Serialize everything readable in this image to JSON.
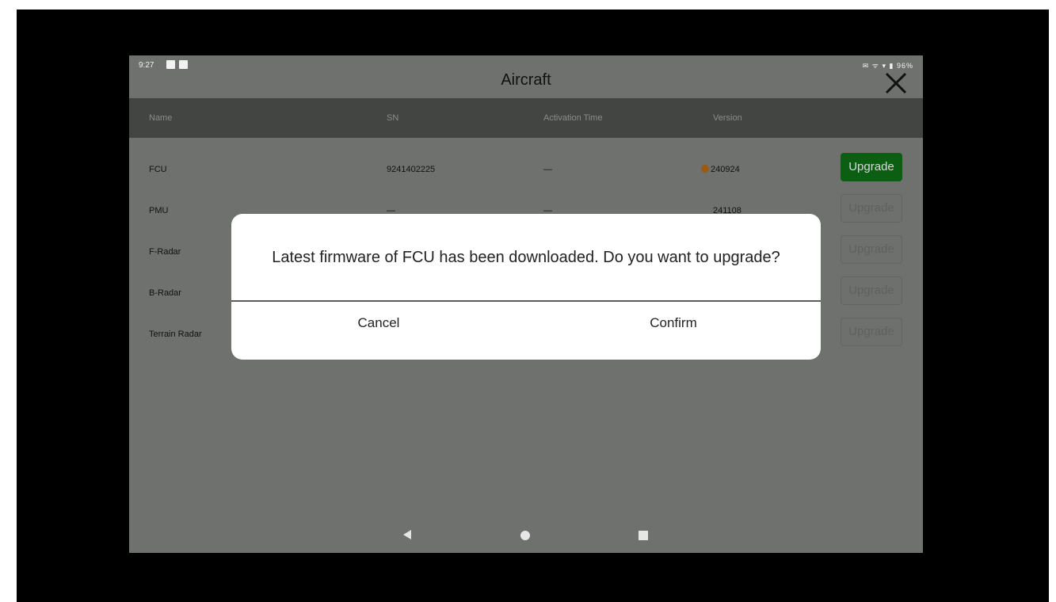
{
  "statusbar": {
    "time": "9:27",
    "right_icons": "✉ ᯤ ▾ ▮ 96%"
  },
  "header": {
    "title": "Aircraft"
  },
  "table": {
    "columns": [
      "Name",
      "SN",
      "Activation Time",
      "Version"
    ],
    "rows": [
      {
        "name": "FCU",
        "sn": "9241402225",
        "activation": "—",
        "version": "240924",
        "button": "Upgrade"
      },
      {
        "name": "PMU",
        "sn": "—",
        "activation": "—",
        "version": "241108",
        "button": "Upgrade"
      },
      {
        "name": "F-Radar",
        "sn": "",
        "activation": "",
        "version": "",
        "button": "Upgrade"
      },
      {
        "name": "B-Radar",
        "sn": "",
        "activation": "",
        "version": "",
        "button": "Upgrade"
      },
      {
        "name": "Terrain Radar",
        "sn": "",
        "activation": "",
        "version": "",
        "button": "Upgrade"
      }
    ]
  },
  "dialog": {
    "message": "Latest firmware of FCU has been downloaded. Do you want to upgrade?",
    "cancel": "Cancel",
    "confirm": "Confirm"
  },
  "colors": {
    "screen_bg": "#6f716f",
    "header_bg": "#434543",
    "upgrade_active": "#0c5e13",
    "version_dot": "#9b5a14"
  },
  "icons": [
    "close-icon",
    "nav-back-icon",
    "nav-home-icon",
    "nav-recent-icon",
    "version-update-dot-icon"
  ]
}
